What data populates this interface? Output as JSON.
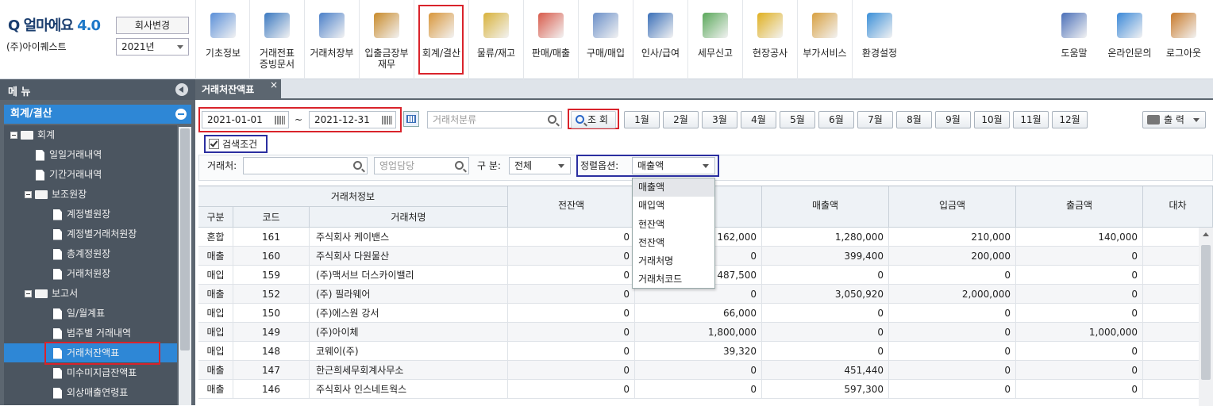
{
  "app": {
    "logo_text": "얼마에요",
    "logo_version": "4.0",
    "company_name": "(주)아이퀘스트",
    "change_company_label": "회사변경",
    "year_value": "2021년"
  },
  "toolbar": [
    {
      "label": "기초정보",
      "icon": "basic-info-icon",
      "color": "#5a8fd8"
    },
    {
      "label": "거래전표\n증빙문서",
      "icon": "voucher-icon",
      "color": "#3a78c0"
    },
    {
      "label": "거래처장부",
      "icon": "ledger-icon",
      "color": "#4a7fc8"
    },
    {
      "label": "입출금장부\n재무",
      "icon": "money-bag-icon",
      "color": "#c88a2a"
    },
    {
      "label": "회계/결산",
      "icon": "accounting-icon",
      "color": "#d8963a"
    },
    {
      "label": "물류/재고",
      "icon": "cart-icon",
      "color": "#d8b23a"
    },
    {
      "label": "판매/매출",
      "icon": "sales-icon",
      "color": "#d85a4a"
    },
    {
      "label": "구매/매입",
      "icon": "purchase-icon",
      "color": "#6a8fc8"
    },
    {
      "label": "인사/급여",
      "icon": "hr-icon",
      "color": "#3a6fb8"
    },
    {
      "label": "세무신고",
      "icon": "tax-icon",
      "color": "#5aa85a"
    },
    {
      "label": "현장공사",
      "icon": "construction-icon",
      "color": "#e0b020"
    },
    {
      "label": "부가서비스",
      "icon": "building-icon",
      "color": "#d8a040"
    },
    {
      "label": "환경설정",
      "icon": "gear-icon",
      "color": "#3a8fd8"
    }
  ],
  "toolbar_right": [
    {
      "label": "도움말",
      "icon": "help-book-icon",
      "color": "#4a6fb8"
    },
    {
      "label": "온라인문의",
      "icon": "online-support-icon",
      "color": "#3a88d8"
    },
    {
      "label": "로그아웃",
      "icon": "logout-door-icon",
      "color": "#c87a2a"
    }
  ],
  "nav": {
    "title": "메 뉴",
    "section": "회계/결산"
  },
  "tree": [
    {
      "label": "회계",
      "type": "folder",
      "level": 0
    },
    {
      "label": "일일거래내역",
      "type": "doc",
      "level": 1
    },
    {
      "label": "기간거래내역",
      "type": "doc",
      "level": 1
    },
    {
      "label": "보조원장",
      "type": "folder",
      "level": 0.5
    },
    {
      "label": "계정별원장",
      "type": "doc",
      "level": 2
    },
    {
      "label": "계정별거래처원장",
      "type": "doc",
      "level": 2
    },
    {
      "label": "총계정원장",
      "type": "doc",
      "level": 2
    },
    {
      "label": "거래처원장",
      "type": "doc",
      "level": 2
    },
    {
      "label": "보고서",
      "type": "folder",
      "level": 0.5
    },
    {
      "label": "일/월계표",
      "type": "doc",
      "level": 2
    },
    {
      "label": "범주별 거래내역",
      "type": "doc",
      "level": 2
    },
    {
      "label": "거래처잔액표",
      "type": "doc",
      "level": 2,
      "current": true
    },
    {
      "label": "미수미지급잔액표",
      "type": "doc",
      "level": 2
    },
    {
      "label": "외상매출연령표",
      "type": "doc",
      "level": 2
    }
  ],
  "tab": {
    "label": "거래처잔액표",
    "close": "×"
  },
  "filters": {
    "date_from": "2021-01-01",
    "date_tilde": "~",
    "date_to": "2021-12-31",
    "category_placeholder": "거래처분류",
    "search_label": "조 회",
    "months": [
      "1월",
      "2월",
      "3월",
      "4월",
      "5월",
      "6월",
      "7월",
      "8월",
      "9월",
      "10월",
      "11월",
      "12월"
    ],
    "print_label": "출 력",
    "search_condition_label": "검색조건",
    "vendor_label": "거래처:",
    "sales_rep_placeholder": "영업담당",
    "type_label": "구 분:",
    "type_value": "전체",
    "sort_label": "정렬옵션:",
    "sort_value": "매출액"
  },
  "sort_options": [
    "매출액",
    "매입액",
    "현잔액",
    "전잔액",
    "거래처명",
    "거래처코드"
  ],
  "table": {
    "group_header": "거래처정보",
    "sub_headers": [
      "구분",
      "코드",
      "거래처명"
    ],
    "columns": [
      "전잔액",
      "",
      "매출액",
      "입금액",
      "출금액",
      "대차"
    ],
    "rows": [
      [
        "혼합",
        "161",
        "주식회사 케이밴스",
        "0",
        "162,000",
        "1,280,000",
        "210,000",
        "140,000"
      ],
      [
        "매출",
        "160",
        "주식회사 다원물산",
        "0",
        "0",
        "399,400",
        "200,000",
        "0"
      ],
      [
        "매입",
        "159",
        "(주)맥서브 더스카이밸리",
        "0",
        "487,500",
        "0",
        "0",
        "0"
      ],
      [
        "매출",
        "152",
        "(주) 필라웨어",
        "0",
        "0",
        "3,050,920",
        "2,000,000",
        "0"
      ],
      [
        "매입",
        "150",
        "(주)에스원 강서",
        "0",
        "66,000",
        "0",
        "0",
        "0"
      ],
      [
        "매입",
        "149",
        "(주)아이체",
        "0",
        "1,800,000",
        "0",
        "0",
        "1,000,000"
      ],
      [
        "매입",
        "148",
        "코웨이(주)",
        "0",
        "39,320",
        "0",
        "0",
        "0"
      ],
      [
        "매출",
        "147",
        "한근희세무회계사무소",
        "0",
        "0",
        "451,440",
        "0",
        "0"
      ],
      [
        "매출",
        "146",
        "주식회사 인스네트웍스",
        "0",
        "0",
        "597,300",
        "0",
        "0"
      ]
    ]
  }
}
